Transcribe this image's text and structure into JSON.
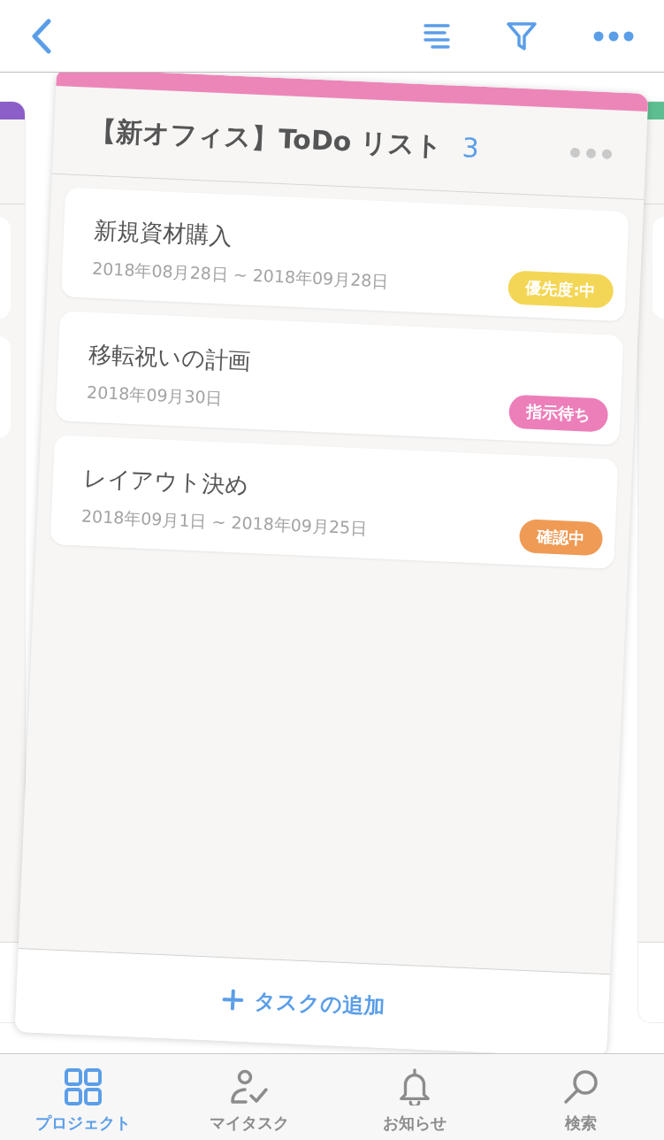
{
  "neighbor_lists": [
    {
      "color": "#8b5ec8"
    },
    {
      "color": "#5dbf91"
    }
  ],
  "dragged_list": {
    "color": "#ec86b9",
    "title": "【新オフィス】ToDo リスト",
    "count": "3",
    "tasks": [
      {
        "title": "新規資材購入",
        "date": "2018年08月28日 ~ 2018年09月28日",
        "tag": {
          "label": "優先度:中",
          "color": "#f4d656"
        }
      },
      {
        "title": "移転祝いの計画",
        "date": "2018年09月30日",
        "tag": {
          "label": "指示待ち",
          "color": "#ec7fba"
        }
      },
      {
        "title": "レイアウト決め",
        "date": "2018年09月1日 ~ 2018年09月25日",
        "tag": {
          "label": "確認中",
          "color": "#ef9b55"
        }
      }
    ],
    "add_button": "タスクの追加"
  },
  "tab_bar": [
    {
      "kind": "projects",
      "label": "プロジェクト",
      "selected": true
    },
    {
      "kind": "my_tasks",
      "label": "マイタスク",
      "selected": false
    },
    {
      "kind": "notifications",
      "label": "お知らせ",
      "selected": false
    },
    {
      "kind": "search",
      "label": "検索",
      "selected": false
    }
  ]
}
